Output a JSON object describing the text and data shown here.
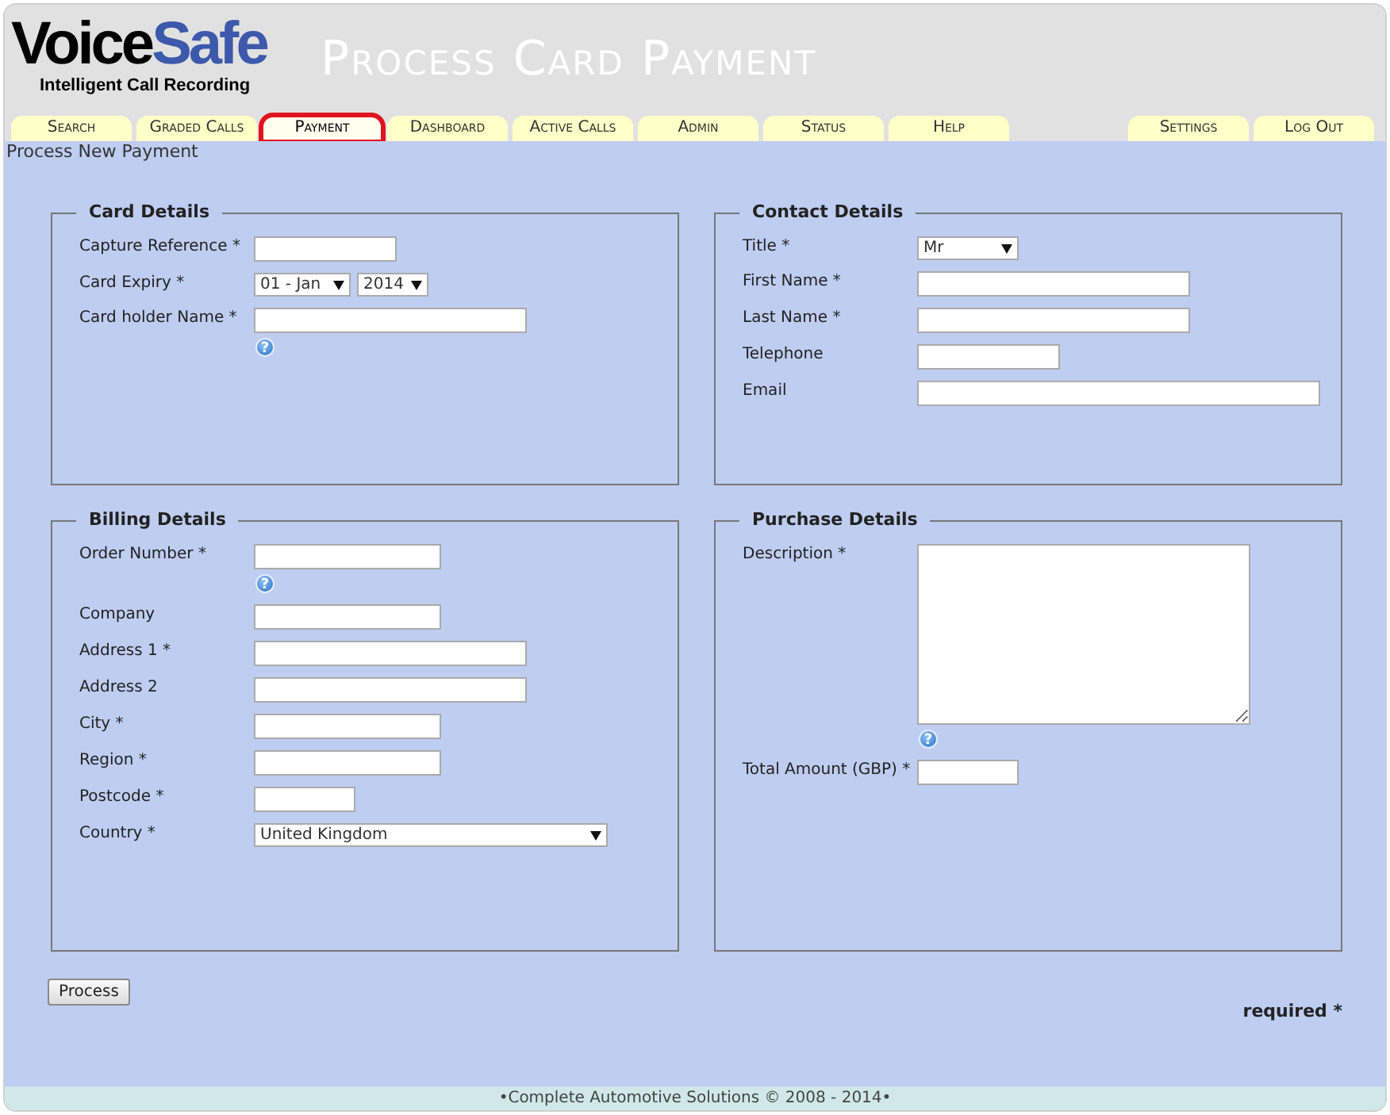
{
  "header": {
    "logo": {
      "first": "Voice",
      "second": "Safe",
      "tagline": "Intelligent Call Recording"
    },
    "title": "Process Card Payment"
  },
  "tabs": [
    {
      "label": "Search",
      "selected": false
    },
    {
      "label": "Graded Calls",
      "selected": false
    },
    {
      "label": "Payment",
      "selected": true
    },
    {
      "label": "Dashboard",
      "selected": false
    },
    {
      "label": "Active Calls",
      "selected": false
    },
    {
      "label": "Admin",
      "selected": false
    },
    {
      "label": "Status",
      "selected": false
    },
    {
      "label": "Help",
      "selected": false
    }
  ],
  "account_tabs": [
    {
      "label": "Settings",
      "selected": false
    },
    {
      "label": "Log Out",
      "selected": false
    }
  ],
  "breadcrumb": "Process New Payment",
  "sections": [
    {
      "title": "Card Details",
      "fields": [
        {
          "label": "Capture Reference *",
          "kind": "medium"
        },
        {
          "label": "Card Expiry *",
          "kind": "selects",
          "values": [
            "01 - Jan",
            "2014"
          ]
        },
        {
          "label": "Card holder Name *",
          "kind": "large",
          "help": "?"
        }
      ]
    },
    {
      "title": "Contact Details",
      "fields": [
        {
          "label": "Title *",
          "kind": "narrowselect",
          "value": "Mr"
        },
        {
          "label": "First Name *",
          "kind": "large"
        },
        {
          "label": "Last Name *",
          "kind": "large"
        },
        {
          "label": "Telephone",
          "kind": "medium"
        },
        {
          "label": "Email",
          "kind": "xlarge"
        }
      ]
    },
    {
      "title": "Billing Details",
      "fields": [
        {
          "label": "Order Number *",
          "kind": "mediumplus",
          "help": "?"
        },
        {
          "label": "Company",
          "kind": "mediumplus"
        },
        {
          "label": "Address 1 *",
          "kind": "large"
        },
        {
          "label": "Address 2",
          "kind": "large"
        },
        {
          "label": "City *",
          "kind": "mediumplus"
        },
        {
          "label": "Region *",
          "kind": "mediumplus"
        },
        {
          "label": "Postcode *",
          "kind": "small"
        },
        {
          "label": "Country *",
          "kind": "wideselect",
          "value": "United Kingdom"
        }
      ]
    },
    {
      "title": "Purchase Details",
      "fields": [
        {
          "label": "Description *",
          "kind": "textarea",
          "help": "?"
        },
        {
          "label": "Total Amount (GBP) *",
          "kind": "small"
        }
      ]
    }
  ],
  "process_button": "Process",
  "required_note": "required *",
  "footer": "•Complete Automotive Solutions © 2008 - 2014•"
}
